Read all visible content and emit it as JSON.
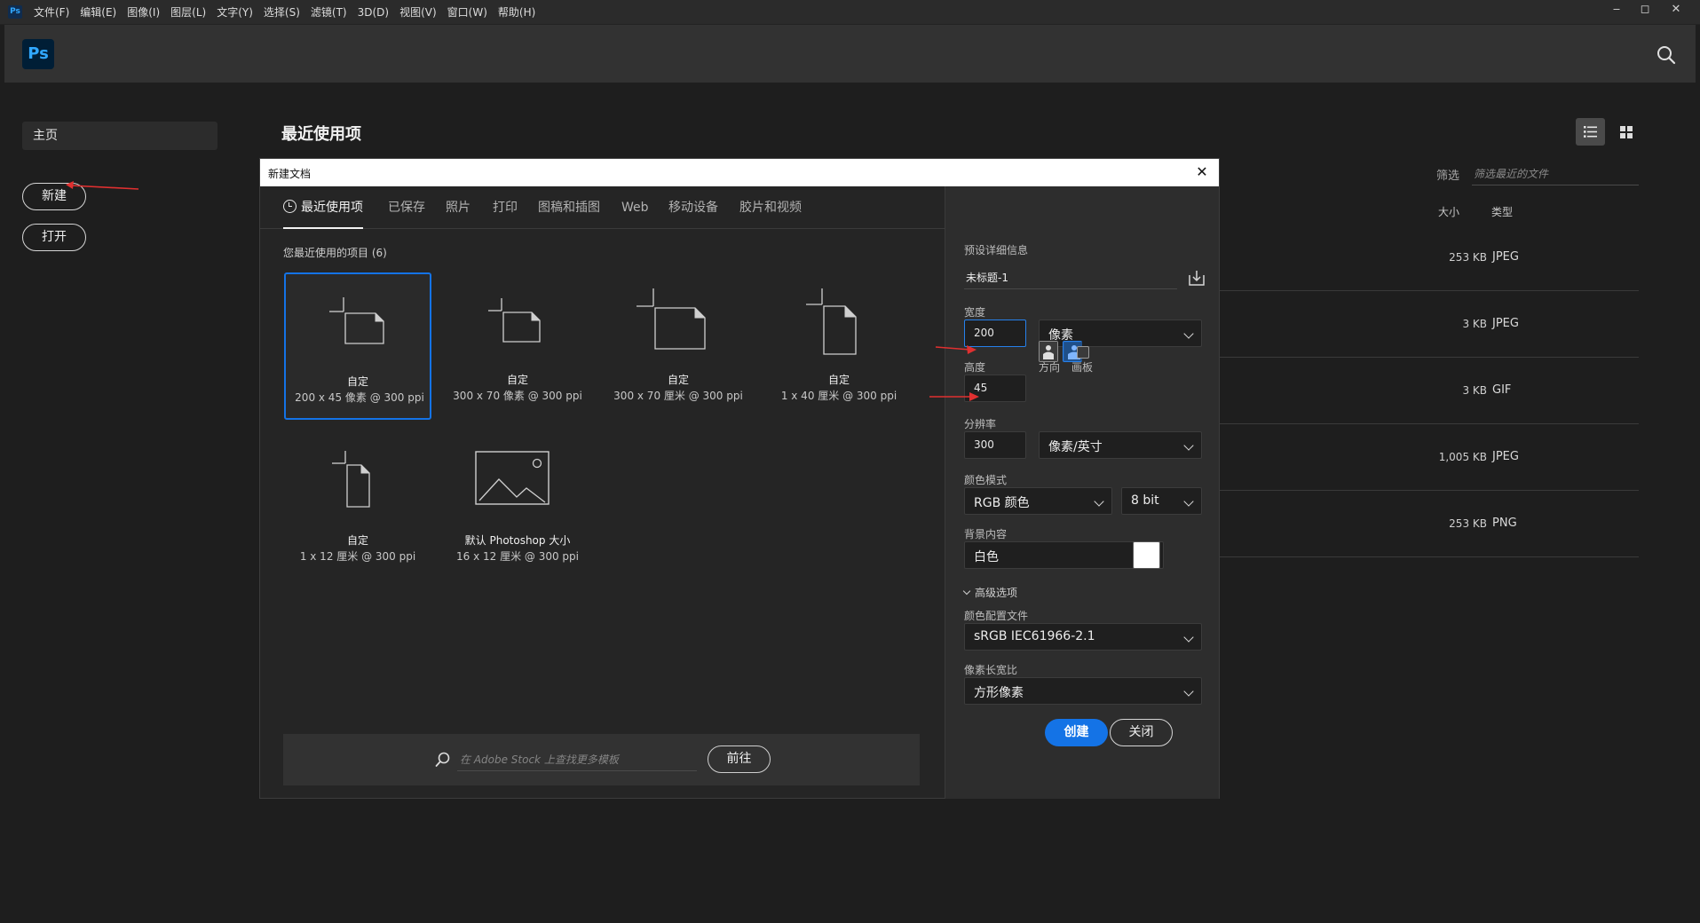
{
  "menubar": {
    "app_badge": "Ps",
    "items": [
      "文件(F)",
      "编辑(E)",
      "图像(I)",
      "图层(L)",
      "文字(Y)",
      "选择(S)",
      "滤镜(T)",
      "3D(D)",
      "视图(V)",
      "窗口(W)",
      "帮助(H)"
    ]
  },
  "header": {
    "logo": "Ps",
    "search_icon": "search-icon"
  },
  "home": {
    "nav_home": "主页",
    "new_button": "新建",
    "open_button": "打开",
    "recent_heading": "最近使用项",
    "filter_label": "筛选",
    "filter_placeholder": "筛选最近的文件",
    "columns": {
      "size": "大小",
      "type": "类型"
    },
    "files": [
      {
        "size": "253 KB",
        "type": "JPEG"
      },
      {
        "size": "3 KB",
        "type": "JPEG"
      },
      {
        "size": "3 KB",
        "type": "GIF"
      },
      {
        "size": "1,005 KB",
        "type": "JPEG"
      },
      {
        "size": "253 KB",
        "type": "PNG"
      }
    ]
  },
  "dialog": {
    "title": "新建文档",
    "close_glyph": "✕",
    "tabs": [
      "最近使用项",
      "已保存",
      "照片",
      "打印",
      "图稿和插图",
      "Web",
      "移动设备",
      "胶片和视频"
    ],
    "recent_label": "您最近使用的项目 (6)",
    "presets": [
      {
        "name": "自定",
        "desc": "200 x 45 像素 @ 300 ppi",
        "selected": true
      },
      {
        "name": "自定",
        "desc": "300 x 70 像素 @ 300 ppi",
        "selected": false
      },
      {
        "name": "自定",
        "desc": "300 x 70 厘米 @ 300 ppi",
        "selected": false
      },
      {
        "name": "自定",
        "desc": "1 x 40 厘米 @ 300 ppi",
        "selected": false
      },
      {
        "name": "自定",
        "desc": "1 x 12 厘米 @ 300 ppi",
        "selected": false
      },
      {
        "name": "默认 Photoshop 大小",
        "desc": "16 x 12 厘米 @ 300 ppi",
        "selected": false
      }
    ],
    "stock_placeholder": "在 Adobe Stock 上查找更多模板",
    "stock_go": "前往",
    "details": {
      "section_label": "预设详细信息",
      "preset_name": "未标题-1",
      "width_label": "宽度",
      "width_value": "200",
      "width_unit": "像素",
      "height_label": "高度",
      "height_value": "45",
      "orientation_label": "方向",
      "artboard_label": "画板",
      "resolution_label": "分辨率",
      "resolution_value": "300",
      "resolution_unit": "像素/英寸",
      "color_mode_label": "颜色模式",
      "color_mode": "RGB 颜色",
      "bit_depth": "8 bit",
      "bg_label": "背景内容",
      "bg_value": "白色",
      "bg_color": "#ffffff",
      "advanced_label": "高级选项",
      "profile_label": "颜色配置文件",
      "profile_value": "sRGB IEC61966-2.1",
      "pixel_aspect_label": "像素长宽比",
      "pixel_aspect_value": "方形像素",
      "create_button": "创建",
      "close_button": "关闭"
    }
  },
  "colors": {
    "accent": "#1473e6",
    "focus": "#2680eb",
    "annotation": "#e03030"
  }
}
